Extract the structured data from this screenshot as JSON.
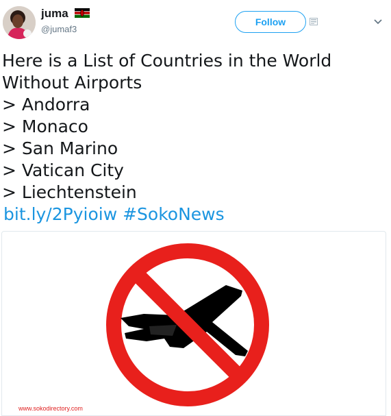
{
  "user": {
    "display_name": "juma",
    "handle": "@jumaf3"
  },
  "follow_label": "Follow",
  "tweet": {
    "lines": [
      "Here is a List of Countries in the World",
      "Without Airports",
      "> Andorra",
      "> Monaco",
      "> San Marino",
      "> Vatican City",
      "> Liechtenstein"
    ],
    "link": "bit.ly/2Pyioiw",
    "hashtag": "#SokoNews"
  },
  "media": {
    "watermark": "www.sokodirectory.com"
  },
  "colors": {
    "accent": "#1da1f2",
    "link": "#1b95e0",
    "text": "#14171a",
    "muted": "#657786",
    "sign_red": "#e8201c"
  },
  "icons": {
    "flag": "kenya-flag-icon",
    "sms": "sms-icon",
    "caret": "chevron-down-icon",
    "sign": "no-airplanes-sign"
  }
}
